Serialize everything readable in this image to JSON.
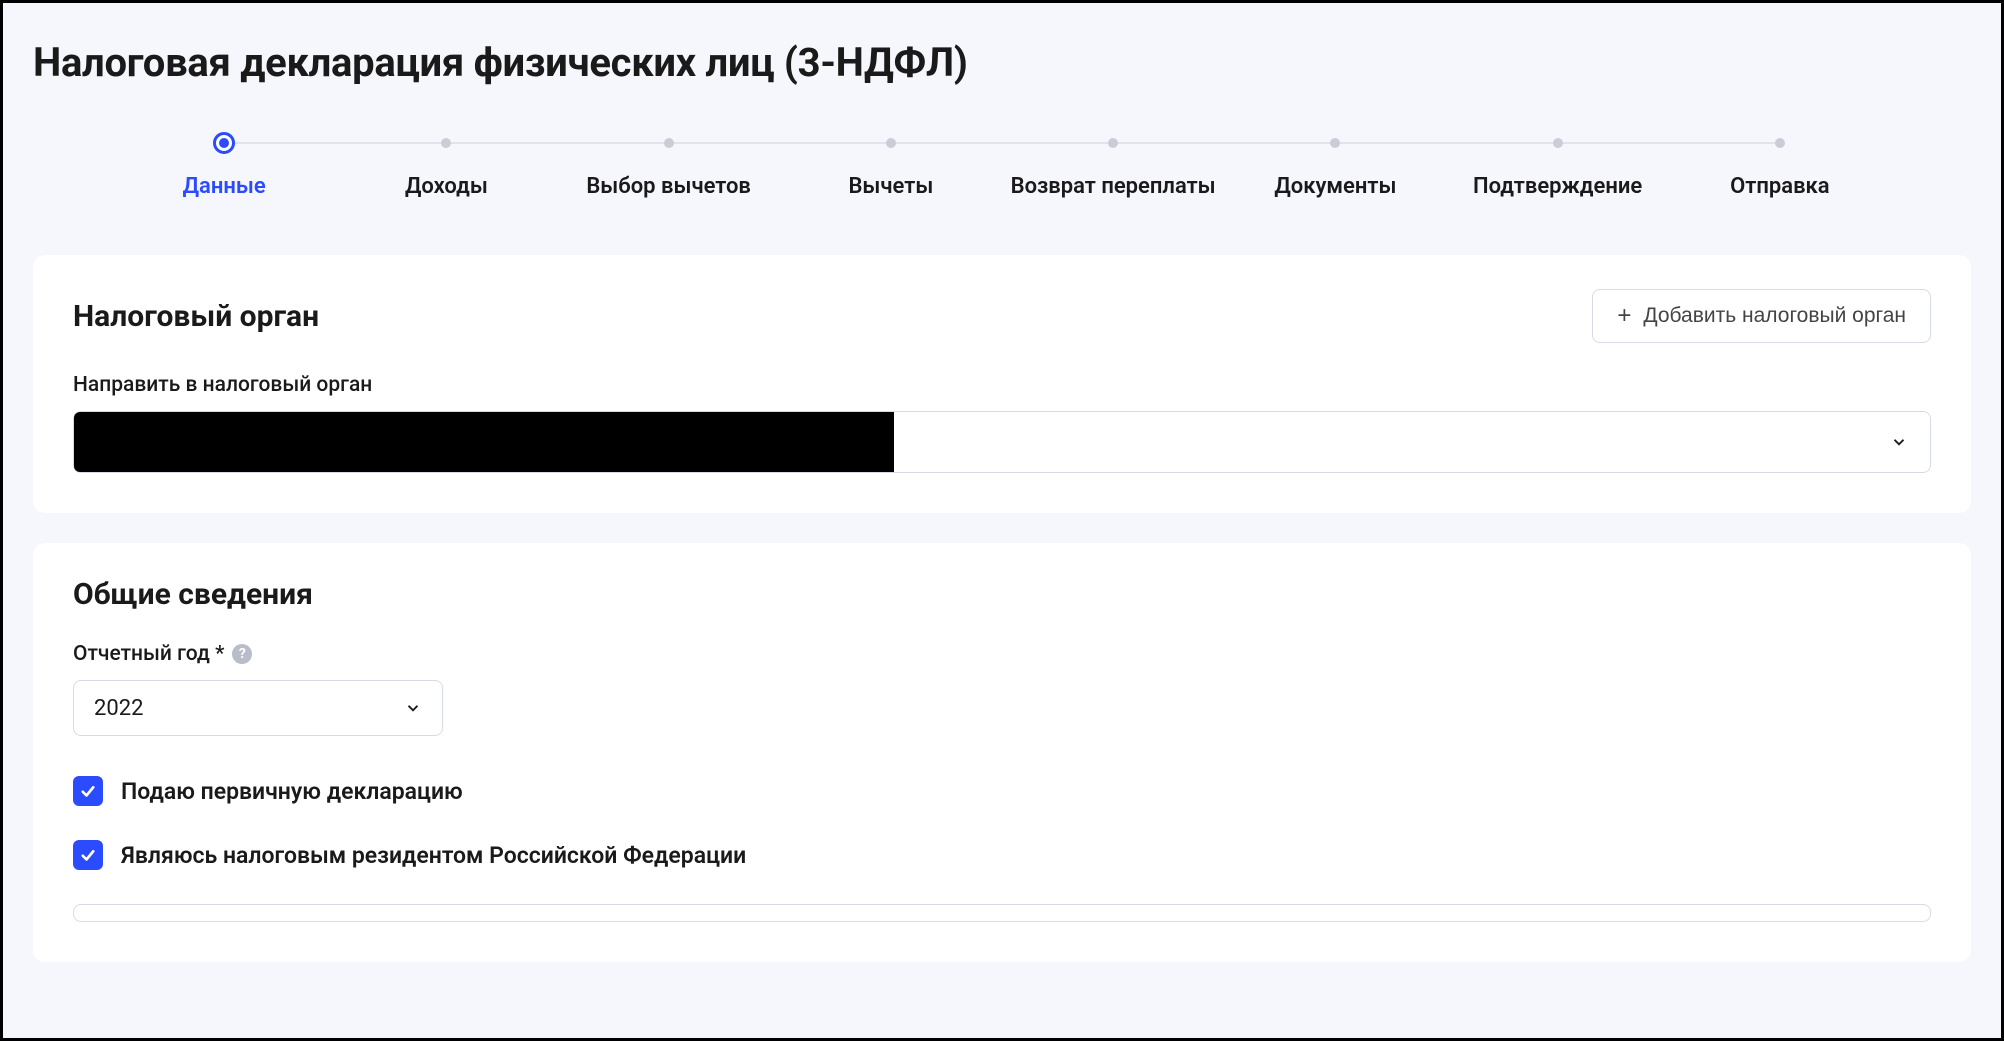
{
  "page_title": "Налоговая декларация физических лиц (3-НДФЛ)",
  "stepper": {
    "steps": [
      {
        "label": "Данные",
        "active": true
      },
      {
        "label": "Доходы",
        "active": false
      },
      {
        "label": "Выбор вычетов",
        "active": false
      },
      {
        "label": "Вычеты",
        "active": false
      },
      {
        "label": "Возврат переплаты",
        "active": false
      },
      {
        "label": "Документы",
        "active": false
      },
      {
        "label": "Подтверждение",
        "active": false
      },
      {
        "label": "Отправка",
        "active": false
      }
    ]
  },
  "tax_authority": {
    "title": "Налоговый орган",
    "add_button": "Добавить налоговый орган",
    "field_label": "Направить в налоговый орган",
    "selected_value": ""
  },
  "general": {
    "title": "Общие сведения",
    "year_label": "Отчетный год *",
    "year_value": "2022",
    "primary_declaration_label": "Подаю первичную декларацию",
    "primary_declaration_checked": true,
    "tax_resident_label": "Являюсь налоговым резидентом Российской Федерации",
    "tax_resident_checked": true
  }
}
